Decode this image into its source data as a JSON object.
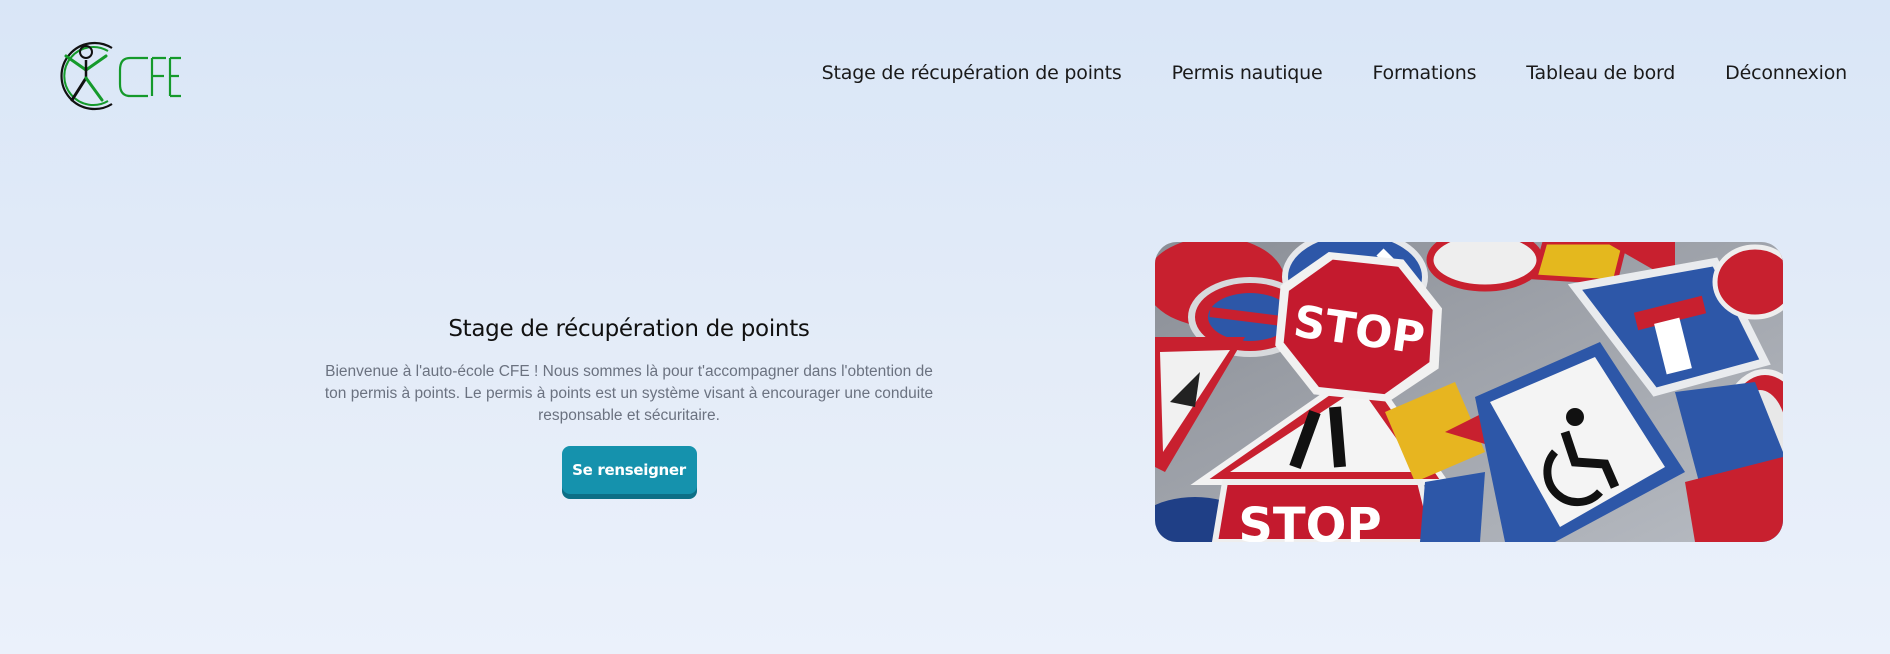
{
  "header": {
    "logo": {
      "icon": "person-in-circle-icon",
      "text": "CFE",
      "color": "#159a2b"
    },
    "nav": [
      {
        "label": "Stage de récupération de points"
      },
      {
        "label": "Permis nautique"
      },
      {
        "label": "Formations"
      },
      {
        "label": "Tableau de bord"
      },
      {
        "label": "Déconnexion"
      }
    ]
  },
  "hero": {
    "title": "Stage de récupération de points",
    "description": "Bienvenue à l'auto-école CFE ! Nous sommes là pour t'accompagner dans l'obtention de ton permis à points. Le permis à points est un système visant à encourager une conduite responsable et sécuritaire.",
    "button_label": "Se renseigner",
    "image": {
      "subject": "pile of road traffic signs",
      "sign_text": "STOP"
    }
  },
  "colors": {
    "accent": "#1592ad",
    "logo_green": "#159a2b",
    "background": "#dfe9f7"
  }
}
